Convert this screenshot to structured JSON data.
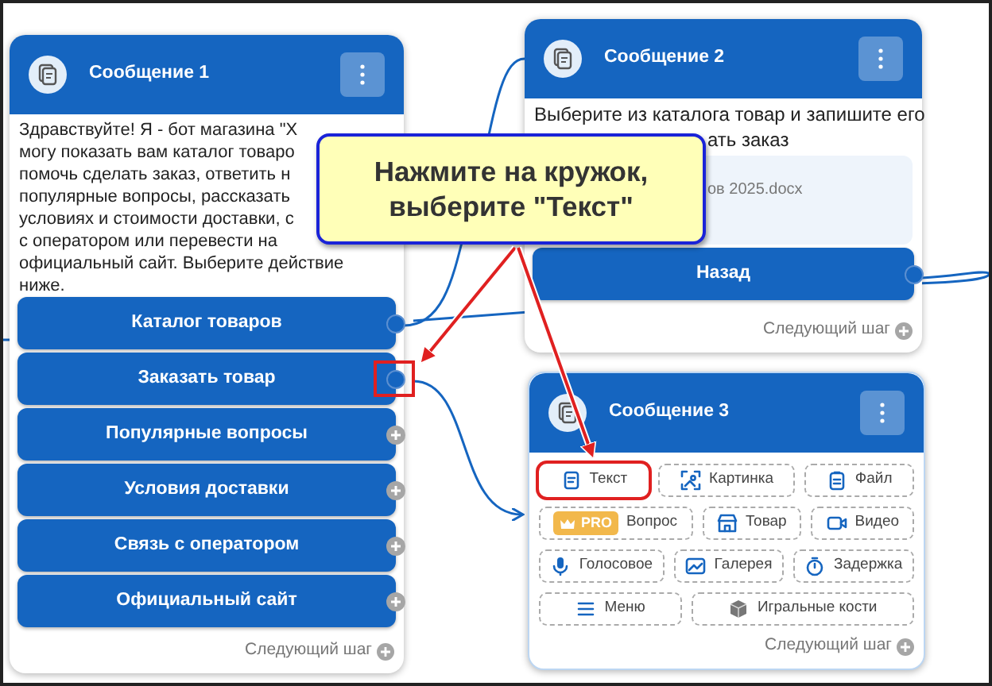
{
  "cards": [
    {
      "title": "Сообщение 1",
      "text_lines": [
        "Здравствуйте! Я - бот магазина \"Х",
        "могу показать вам каталог товаро",
        "помочь сделать заказ, ответить н",
        "популярные вопросы, рассказать",
        "условиях и стоимости доставки, с",
        "с оператором или перевести на",
        "официальный сайт. Выберите действие",
        "ниже."
      ],
      "buttons": [
        {
          "label": "Каталог товаров",
          "linked": true,
          "highlighted": false
        },
        {
          "label": "Заказать товар",
          "linked": true,
          "highlighted": true
        },
        {
          "label": "Популярные вопросы",
          "linked": false,
          "highlighted": false
        },
        {
          "label": "Условия доставки",
          "linked": false,
          "highlighted": false
        },
        {
          "label": "Связь с оператором",
          "linked": false,
          "highlighted": false
        },
        {
          "label": "Официальный сайт",
          "linked": false,
          "highlighted": false
        }
      ],
      "next_step": "Следующий шаг"
    },
    {
      "title": "Сообщение 2",
      "text_lines": [
        "Выберите из каталога товар и запишите его",
        "ать заказ"
      ],
      "file": "ов 2025.docx",
      "buttons": [
        {
          "label": "Назад",
          "linked": true,
          "highlighted": false
        }
      ],
      "next_step": "Следующий шаг"
    },
    {
      "title": "Сообщение 3",
      "blocks": [
        [
          {
            "kind": "text",
            "label": "Текст",
            "highlighted": true
          },
          {
            "kind": "image",
            "label": "Картинка",
            "highlighted": false
          },
          {
            "kind": "file",
            "label": "Файл",
            "highlighted": false
          }
        ],
        [
          {
            "kind": "question",
            "badge": "PRO",
            "label": "Вопрос",
            "highlighted": false
          },
          {
            "kind": "product",
            "label": "Товар",
            "highlighted": false
          },
          {
            "kind": "video",
            "label": "Видео",
            "highlighted": false
          }
        ],
        [
          {
            "kind": "voice",
            "label": "Голосовое",
            "highlighted": false
          },
          {
            "kind": "gallery",
            "label": "Галерея",
            "highlighted": false
          },
          {
            "kind": "delay",
            "label": "Задержка",
            "highlighted": false
          }
        ],
        [
          {
            "kind": "menu",
            "label": "Меню",
            "highlighted": false
          },
          {
            "kind": "dice",
            "label": "Игральные кости",
            "highlighted": false
          }
        ]
      ],
      "next_step": "Следующий шаг"
    }
  ],
  "callout": {
    "lines": [
      "Нажмите на кружок,",
      "выберите \"Текст\""
    ]
  }
}
